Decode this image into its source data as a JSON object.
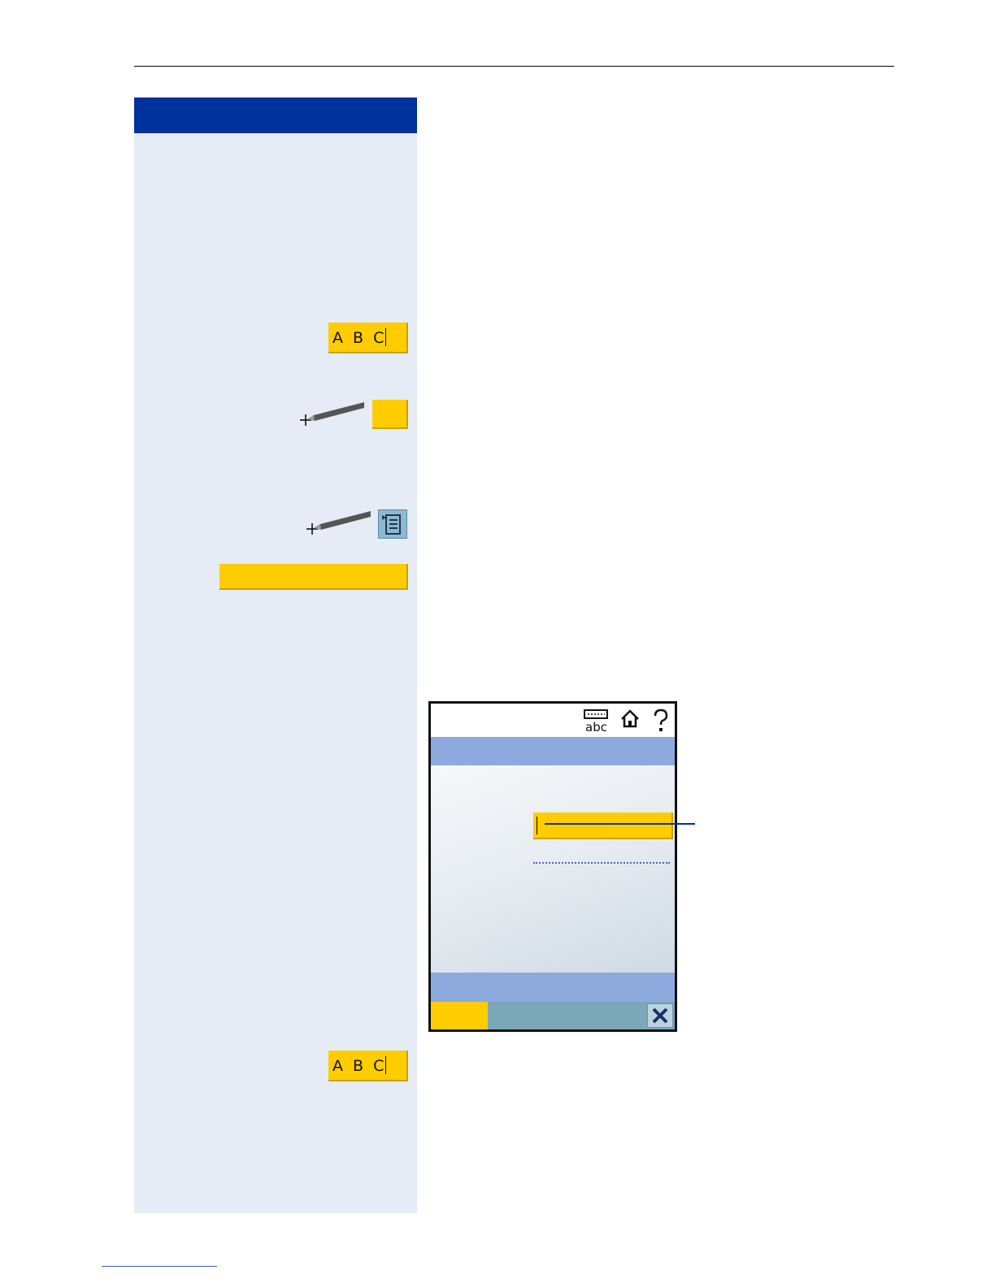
{
  "sidebar": {
    "keys": [
      {
        "label": "A B C"
      },
      {
        "label": "A B C"
      }
    ]
  },
  "device": {
    "status_icons": [
      "keyboard-abc-icon",
      "home-icon",
      "help-icon"
    ],
    "softkey_icons": [
      "close-x-icon"
    ]
  },
  "colors": {
    "header_blue": "#00329b",
    "sidebar_bg": "#e6ecf5",
    "accent_yellow": "#ffcc00",
    "device_bar_blue": "#8caadd",
    "device_softbar": "#7ba8b9"
  }
}
